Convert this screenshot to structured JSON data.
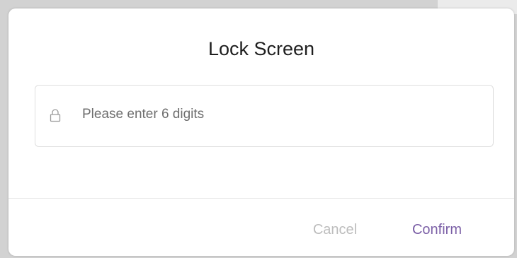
{
  "dialog": {
    "title": "Lock Screen",
    "pin_field": {
      "placeholder": "Please enter 6 digits",
      "value": "",
      "icon": "lock-icon"
    },
    "buttons": {
      "cancel_label": "Cancel",
      "confirm_label": "Confirm"
    }
  },
  "colors": {
    "confirm_text": "#7b5fa6",
    "cancel_text": "#bdbdbd",
    "title_text": "#1e1e1e",
    "backdrop": "#d2d2d2"
  }
}
